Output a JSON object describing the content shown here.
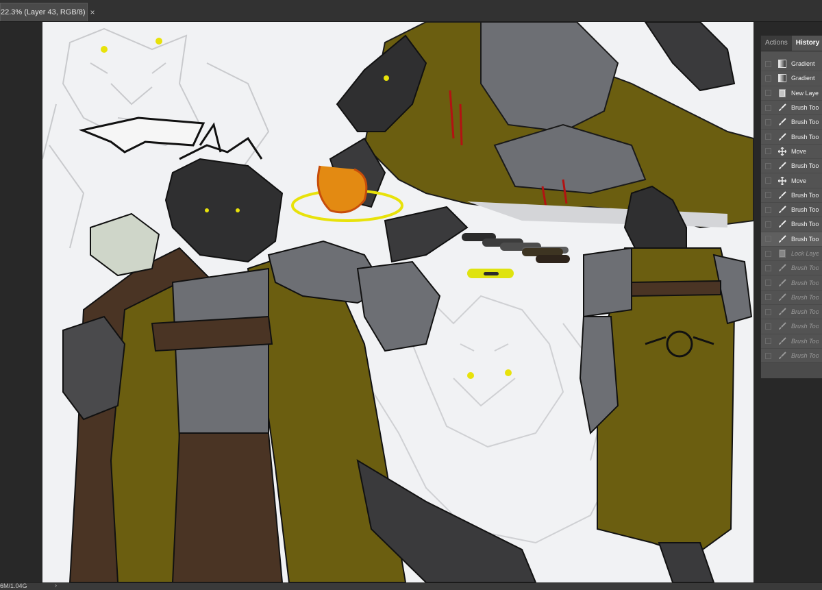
{
  "document_tab": {
    "title": "22.3% (Layer 43, RGB/8)",
    "close_glyph": "×"
  },
  "panel": {
    "tabs": [
      {
        "label": "Actions"
      },
      {
        "label": "History"
      }
    ],
    "history": [
      {
        "label": "Gradient",
        "icon": "gradient-icon",
        "state": "done"
      },
      {
        "label": "Gradient",
        "icon": "gradient-icon",
        "state": "done"
      },
      {
        "label": "New Layer",
        "icon": "new-layer-icon",
        "state": "done"
      },
      {
        "label": "Brush Tool",
        "icon": "brush-icon",
        "state": "done"
      },
      {
        "label": "Brush Tool",
        "icon": "brush-icon",
        "state": "done"
      },
      {
        "label": "Brush Tool",
        "icon": "brush-icon",
        "state": "done"
      },
      {
        "label": "Move",
        "icon": "move-icon",
        "state": "done"
      },
      {
        "label": "Brush Tool",
        "icon": "brush-icon",
        "state": "done"
      },
      {
        "label": "Move",
        "icon": "move-icon",
        "state": "done"
      },
      {
        "label": "Brush Tool",
        "icon": "brush-icon",
        "state": "done"
      },
      {
        "label": "Brush Tool",
        "icon": "brush-icon",
        "state": "done"
      },
      {
        "label": "Brush Tool",
        "icon": "brush-icon",
        "state": "done"
      },
      {
        "label": "Brush Tool",
        "icon": "brush-icon",
        "state": "current"
      },
      {
        "label": "Lock Layer",
        "icon": "new-layer-icon",
        "state": "undone"
      },
      {
        "label": "Brush Tool",
        "icon": "brush-icon",
        "state": "undone"
      },
      {
        "label": "Brush Tool",
        "icon": "brush-icon",
        "state": "undone"
      },
      {
        "label": "Brush Tool",
        "icon": "brush-icon",
        "state": "undone"
      },
      {
        "label": "Brush Tool",
        "icon": "brush-icon",
        "state": "undone"
      },
      {
        "label": "Brush Tool",
        "icon": "brush-icon",
        "state": "undone"
      },
      {
        "label": "Brush Tool",
        "icon": "brush-icon",
        "state": "undone"
      },
      {
        "label": "Brush Tool",
        "icon": "brush-icon",
        "state": "undone"
      }
    ]
  },
  "status_bar": {
    "text": "6M/1.04G",
    "arrow": "›"
  },
  "colors": {
    "canvas_bg": "#f1f2f4",
    "olive_cloak": "#6b5e10",
    "fur_dark": "#2f2f30",
    "armor_gray": "#6d6f74",
    "leather_brown": "#4a3424",
    "eye_yellow": "#e8e20a",
    "blood_red": "#b31212"
  },
  "palette_swatches": [
    "#2b2b2b",
    "#3c3c3c",
    "#4d4d4d",
    "#5c5c5c",
    "#3d3422",
    "#2e241b"
  ],
  "highlight_swatch": "#dfe30f"
}
